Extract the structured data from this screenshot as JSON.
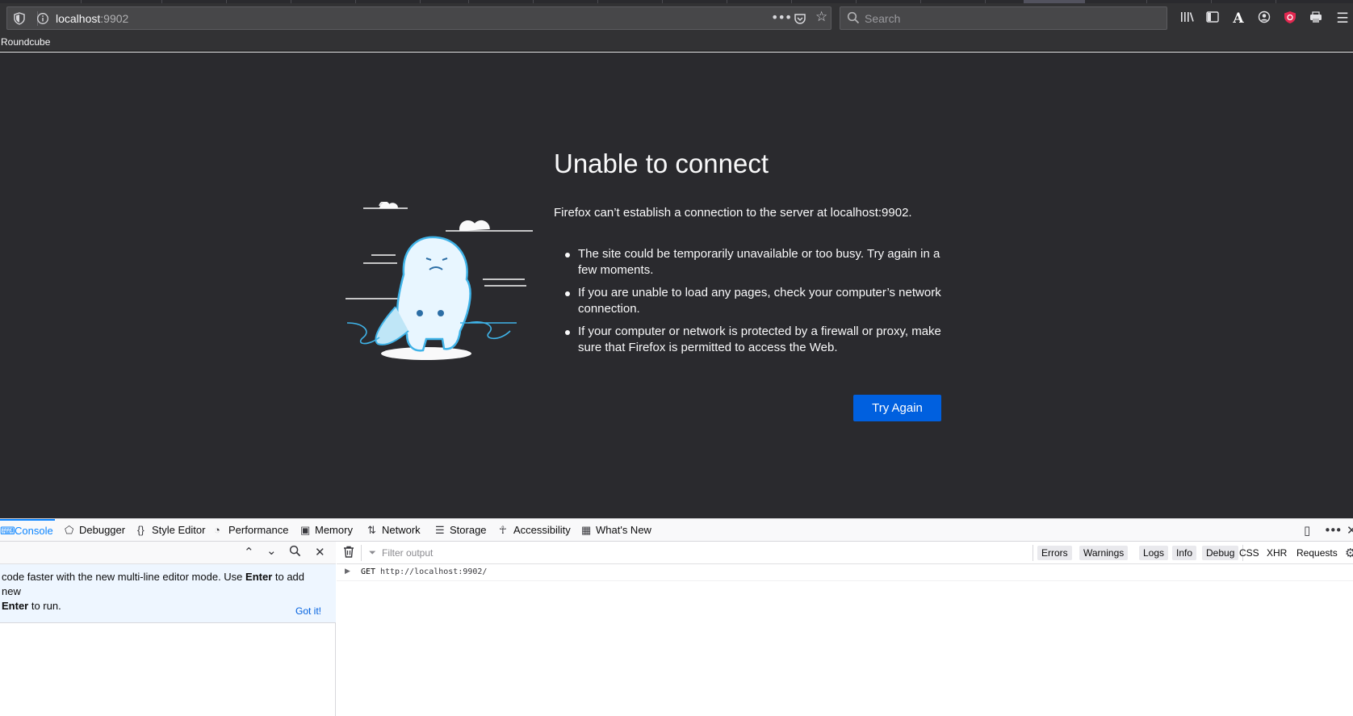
{
  "browser": {
    "url_host": "localhost",
    "url_port": ":9902",
    "search_placeholder": "Search",
    "bookmark": "Roundcube"
  },
  "error_page": {
    "title": "Unable to connect",
    "description": "Firefox can’t establish a connection to the server at localhost:9902.",
    "bullets": [
      "The site could be temporarily unavailable or too busy. Try again in a few moments.",
      "If you are unable to load any pages, check your computer’s network connection.",
      "If your computer or network is protected by a firewall or proxy, make sure that Firefox is permitted to access the Web."
    ],
    "button": "Try Again",
    "accent": "#0060df"
  },
  "devtools": {
    "tabs": [
      "Console",
      "Debugger",
      "Style Editor",
      "Performance",
      "Memory",
      "Network",
      "Storage",
      "Accessibility",
      "What's New"
    ],
    "active_tab": "Console",
    "notice_text_a": "code faster with the new multi-line editor mode. Use ",
    "notice_bold_a": "Enter",
    "notice_text_b": " to add new",
    "notice_bold_b": "Enter",
    "notice_text_c": " to run.",
    "notice_link": "Got it!",
    "filter_placeholder": "Filter output",
    "filters": [
      "Errors",
      "Warnings",
      "Logs",
      "Info",
      "Debug"
    ],
    "filters_extra": [
      "CSS",
      "XHR",
      "Requests"
    ],
    "log": {
      "method": "GET",
      "url": "http://localhost:9902/"
    }
  }
}
